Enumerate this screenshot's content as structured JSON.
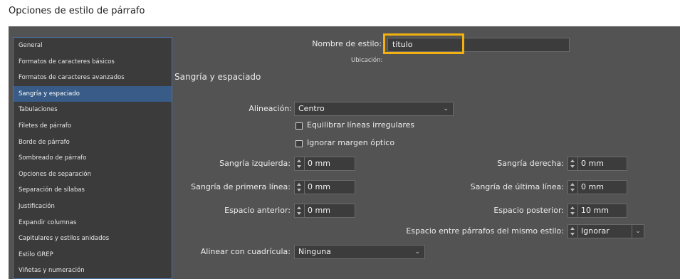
{
  "window": {
    "title": "Opciones de estilo de párrafo"
  },
  "sidebar": {
    "items": [
      {
        "label": "General",
        "selected": false
      },
      {
        "label": "Formatos de caracteres básicos",
        "selected": false
      },
      {
        "label": "Formatos de caracteres avanzados",
        "selected": false
      },
      {
        "label": "Sangría y espaciado",
        "selected": true
      },
      {
        "label": "Tabulaciones",
        "selected": false
      },
      {
        "label": "Filetes de párrafo",
        "selected": false
      },
      {
        "label": "Borde de párrafo",
        "selected": false
      },
      {
        "label": "Sombreado de párrafo",
        "selected": false
      },
      {
        "label": "Opciones de separación",
        "selected": false
      },
      {
        "label": "Separación de sílabas",
        "selected": false
      },
      {
        "label": "Justificación",
        "selected": false
      },
      {
        "label": "Expandir columnas",
        "selected": false
      },
      {
        "label": "Capitulares y estilos anidados",
        "selected": false
      },
      {
        "label": "Estilo GREP",
        "selected": false
      },
      {
        "label": "Viñetas y numeración",
        "selected": false
      }
    ]
  },
  "main": {
    "style_name_label": "Nombre de estilo:",
    "style_name_value": "titulo",
    "location_label": "Ubicación:",
    "section_title": "Sangría y espaciado",
    "alignment_label": "Alineación:",
    "alignment_value": "Centro",
    "balance_label": "Equilibrar líneas irregulares",
    "ignore_margin_label": "Ignorar margen óptico",
    "left_indent_label": "Sangría izquierda:",
    "left_indent_value": "0 mm",
    "right_indent_label": "Sangría derecha:",
    "right_indent_value": "0 mm",
    "first_line_label": "Sangría de primera línea:",
    "first_line_value": "0 mm",
    "last_line_label": "Sangría de última línea:",
    "last_line_value": "0 mm",
    "space_before_label": "Espacio anterior:",
    "space_before_value": "0 mm",
    "space_after_label": "Espacio posterior:",
    "space_after_value": "10 mm",
    "space_same_style_label": "Espacio entre párrafos del mismo estilo:",
    "space_same_style_value": "Ignorar",
    "grid_label": "Alinear con cuadrícula:",
    "grid_value": "Ninguna"
  },
  "colors": {
    "highlight": "#f2b10f",
    "selected": "#385c87",
    "panel": "#535353"
  }
}
